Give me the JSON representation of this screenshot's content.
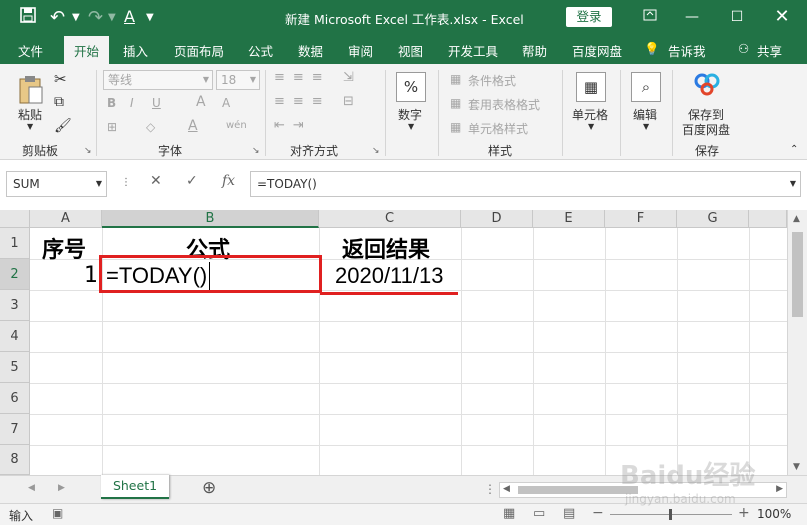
{
  "title_bar": {
    "title": "新建 Microsoft Excel 工作表.xlsx  -  Excel",
    "login_label": "登录"
  },
  "menu": {
    "items": [
      "文件",
      "开始",
      "插入",
      "页面布局",
      "公式",
      "数据",
      "审阅",
      "视图",
      "开发工具",
      "帮助",
      "百度网盘"
    ],
    "tellme": "告诉我",
    "share": "共享"
  },
  "ribbon": {
    "clipboard": {
      "paste": "粘贴",
      "group": "剪贴板"
    },
    "font": {
      "name": "等线",
      "size": "18",
      "group": "字体",
      "bold": "B",
      "italic": "I",
      "underline": "U",
      "grow": "A",
      "shrink": "A",
      "color_letter": "A",
      "phonetic": "wén"
    },
    "align": {
      "group": "对齐方式"
    },
    "number": {
      "label": "数字",
      "symbol": "%"
    },
    "styles": {
      "conditional": "条件格式",
      "table": "套用表格格式",
      "cell": "单元格样式",
      "group": "样式"
    },
    "cells": {
      "label": "单元格"
    },
    "edit": {
      "label": "编辑"
    },
    "save": {
      "line1": "保存到",
      "line2": "百度网盘",
      "group": "保存"
    }
  },
  "formula_bar": {
    "name_box": "SUM",
    "fx": "fx",
    "formula": "=TODAY()"
  },
  "columns": [
    "A",
    "B",
    "C",
    "D",
    "E",
    "F",
    "G"
  ],
  "rows": [
    "1",
    "2",
    "3",
    "4",
    "5",
    "6",
    "7",
    "8"
  ],
  "cells": {
    "A1": "序号",
    "B1": "公式",
    "C1": "返回结果",
    "A2": "1",
    "B2": "=TODAY()",
    "C2": "2020/11/13"
  },
  "sheet_tabs": [
    "Sheet1"
  ],
  "status": {
    "mode": "输入",
    "zoom": "100%"
  },
  "watermark": {
    "logo": "Baidu经验",
    "url": "jingyan.baidu.com"
  },
  "colors": {
    "accent": "#217346",
    "highlight": "#e02020"
  }
}
